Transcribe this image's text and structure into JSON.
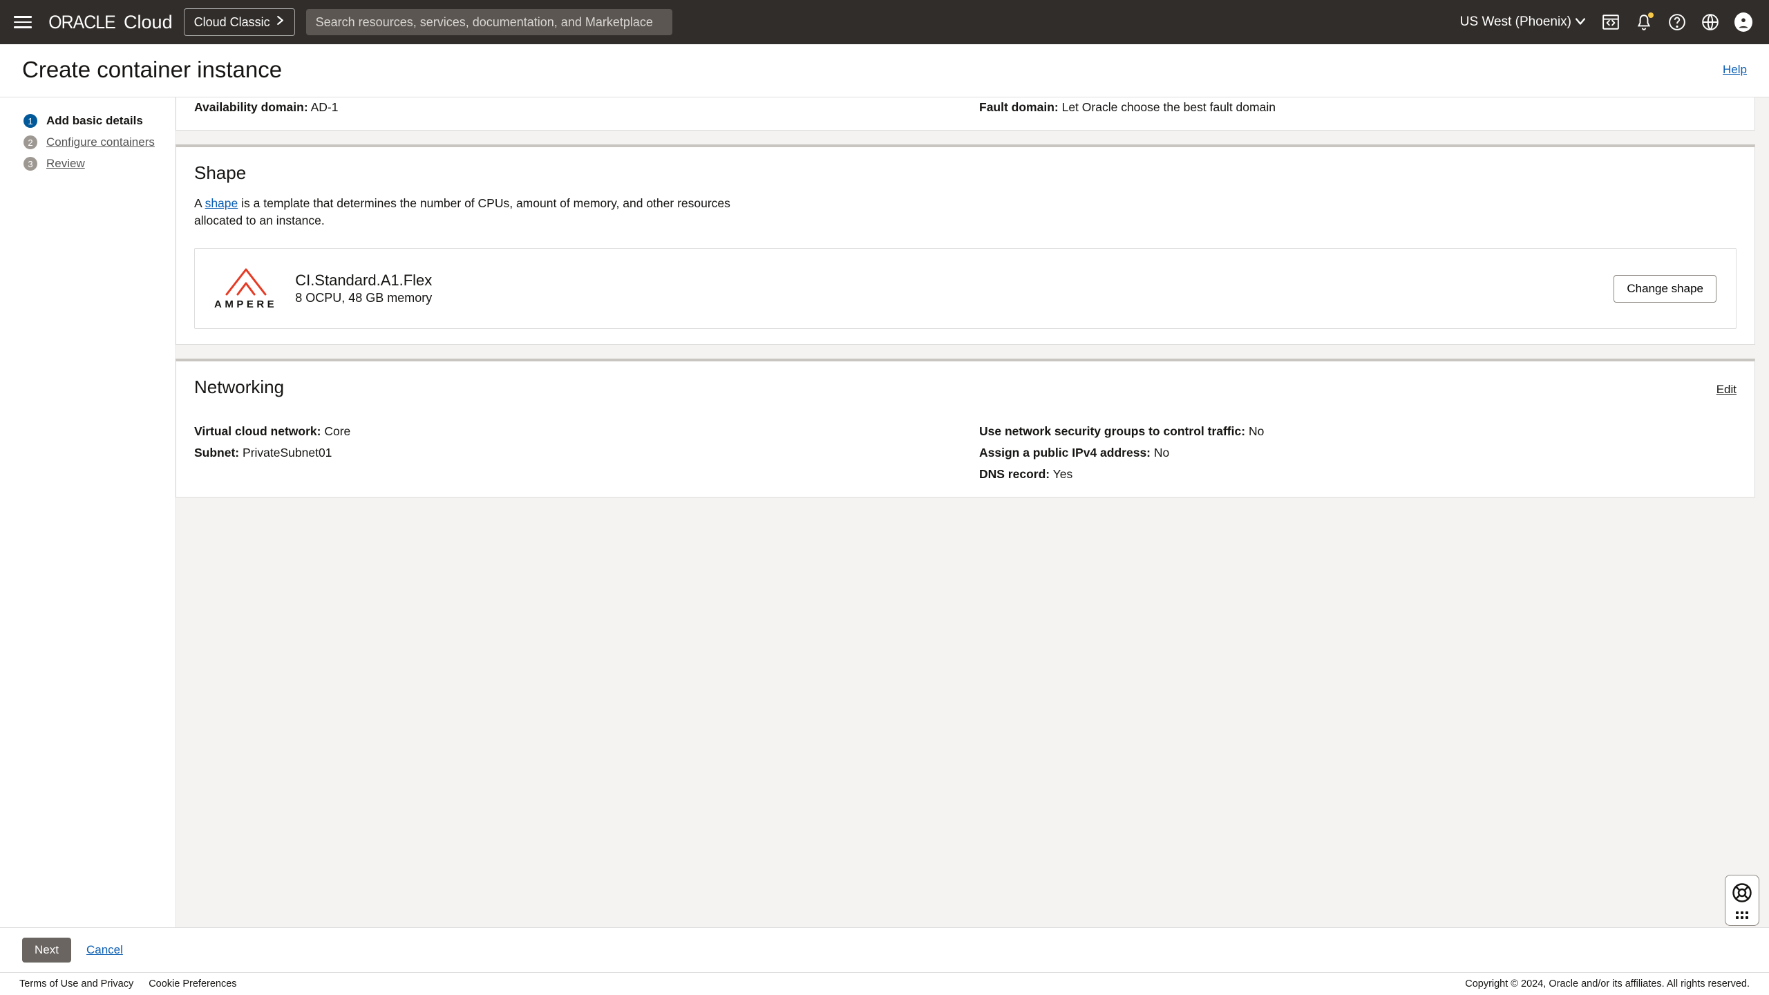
{
  "header": {
    "logo_brand": "ORACLE",
    "logo_product": "Cloud",
    "cloud_classic": "Cloud Classic",
    "search_placeholder": "Search resources, services, documentation, and Marketplace",
    "region": "US West (Phoenix)"
  },
  "page": {
    "title": "Create container instance",
    "help": "Help"
  },
  "steps": [
    {
      "num": "1",
      "label": "Add basic details",
      "active": true
    },
    {
      "num": "2",
      "label": "Configure containers",
      "active": false
    },
    {
      "num": "3",
      "label": "Review",
      "active": false
    }
  ],
  "placement": {
    "avail_label": "Availability domain:",
    "avail_value": "AD-1",
    "fault_label": "Fault domain:",
    "fault_value": "Let Oracle choose the best fault domain"
  },
  "shape": {
    "heading": "Shape",
    "desc_pre": "A ",
    "desc_link": "shape",
    "desc_post": " is a template that determines the number of CPUs, amount of memory, and other resources allocated to an instance.",
    "logo_text": "AMPERE",
    "name": "CI.Standard.A1.Flex",
    "specs": "8 OCPU, 48 GB memory",
    "change_btn": "Change shape"
  },
  "networking": {
    "heading": "Networking",
    "edit": "Edit",
    "vcn_label": "Virtual cloud network:",
    "vcn_value": "Core",
    "subnet_label": "Subnet:",
    "subnet_value": "PrivateSubnet01",
    "nsg_label": "Use network security groups to control traffic:",
    "nsg_value": "No",
    "pubip_label": "Assign a public IPv4 address:",
    "pubip_value": "No",
    "dns_label": "DNS record:",
    "dns_value": "Yes"
  },
  "actions": {
    "next": "Next",
    "cancel": "Cancel"
  },
  "legal": {
    "terms": "Terms of Use and Privacy",
    "cookie": "Cookie Preferences",
    "copyright": "Copyright © 2024, Oracle and/or its affiliates. All rights reserved."
  }
}
